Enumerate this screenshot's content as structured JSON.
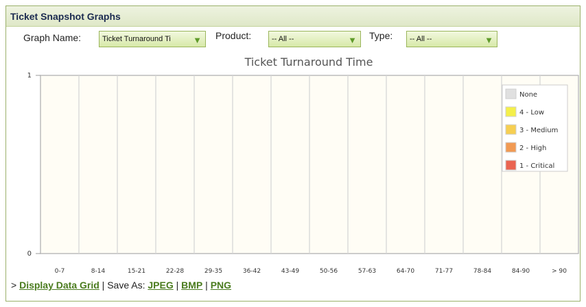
{
  "panel": {
    "title": "Ticket Snapshot Graphs"
  },
  "filters": {
    "graph_name_label": "Graph Name:",
    "graph_name_value": "Ticket Turnaround Ti",
    "product_label": "Product:",
    "product_value": "-- All --",
    "type_label": "Type:",
    "type_value": "-- All --",
    "dropdown_arrow": "▼"
  },
  "chart_data": {
    "type": "bar",
    "title": "Ticket Turnaround Time",
    "xlabel": "",
    "ylabel": "",
    "categories": [
      "0-7",
      "8-14",
      "15-21",
      "22-28",
      "29-35",
      "36-42",
      "43-49",
      "50-56",
      "57-63",
      "64-70",
      "71-77",
      "78-84",
      "84-90",
      "> 90"
    ],
    "ylim": [
      0,
      1
    ],
    "yticks": [
      0,
      1
    ],
    "grid": true,
    "legend_position": "right",
    "series": [
      {
        "name": "None",
        "color": "#e0e0e0",
        "values": [
          0,
          0,
          0,
          0,
          0,
          0,
          0,
          0,
          0,
          0,
          0,
          0,
          0,
          0
        ]
      },
      {
        "name": "4 - Low",
        "color": "#f4ef4a",
        "values": [
          0,
          0,
          0,
          0,
          0,
          0,
          0,
          0,
          0,
          0,
          0,
          0,
          0,
          0
        ]
      },
      {
        "name": "3 - Medium",
        "color": "#f6cf52",
        "values": [
          0,
          0,
          0,
          0,
          0,
          0,
          0,
          0,
          0,
          0,
          0,
          0,
          0,
          0
        ]
      },
      {
        "name": "2 - High",
        "color": "#f19a53",
        "values": [
          0,
          0,
          0,
          0,
          0,
          0,
          0,
          0,
          0,
          0,
          0,
          0,
          0,
          0
        ]
      },
      {
        "name": "1 - Critical",
        "color": "#ea6452",
        "values": [
          0,
          0,
          0,
          0,
          0,
          0,
          0,
          0,
          0,
          0,
          0,
          0,
          0,
          0
        ]
      }
    ]
  },
  "footer": {
    "prefix": "> ",
    "display_grid_link": "Display Data Grid",
    "separator": " | ",
    "save_as_label": "Save As: ",
    "jpeg_link": "JPEG",
    "bmp_link": "BMP",
    "png_link": "PNG"
  }
}
